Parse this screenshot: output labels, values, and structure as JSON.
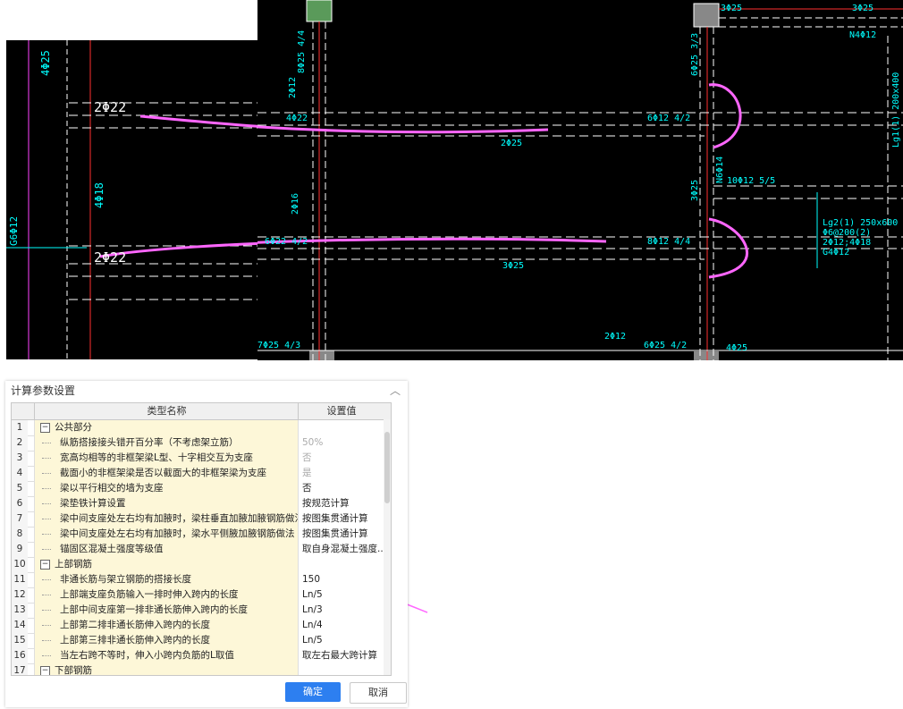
{
  "cad_left": {
    "labels": [
      "4Φ25",
      "2Φ22",
      "4Φ18",
      "G6Φ12",
      "2Φ22"
    ]
  },
  "cad_right": {
    "labels": [
      "8Φ25 4/4",
      "2Φ12",
      "4Φ22",
      "2Φ25",
      "6Φ12 4/2",
      "6Φ25 3/3",
      "3Φ25",
      "3Φ25",
      "N4Φ12",
      "Lg1(1) 200x400",
      "N6Φ14",
      "10Φ12 5/5",
      "3Φ25",
      "2Φ16",
      "6Φ22 4/2",
      "8Φ12 4/4",
      "3Φ25",
      "Lg2(1) 250x600",
      "Φ6@200(2)",
      "2Φ12;4Φ18",
      "G4Φ12",
      "7Φ25 4/3",
      "2Φ12",
      "6Φ25 4/2",
      "4Φ25"
    ]
  },
  "dialog": {
    "title": "计算参数设置",
    "col_name": "类型名称",
    "col_value": "设置值",
    "ok_label": "确定",
    "cancel_label": "取消",
    "rows": [
      {
        "num": "1",
        "name": "公共部分",
        "value": "",
        "group": true
      },
      {
        "num": "2",
        "name": "纵筋搭接接头错开百分率（不考虑架立筋）",
        "value": "50%",
        "disabled": true
      },
      {
        "num": "3",
        "name": "宽高均相等的非框架梁L型、十字相交互为支座",
        "value": "否",
        "disabled": true
      },
      {
        "num": "4",
        "name": "截面小的非框架梁是否以截面大的非框架梁为支座",
        "value": "是",
        "disabled": true
      },
      {
        "num": "5",
        "name": "梁以平行相交的墙为支座",
        "value": "否"
      },
      {
        "num": "6",
        "name": "梁垫铁计算设置",
        "value": "按规范计算"
      },
      {
        "num": "7",
        "name": "梁中间支座处左右均有加腋时，梁柱垂直加腋加腋钢筋做法",
        "value": "按图集贯通计算"
      },
      {
        "num": "8",
        "name": "梁中间支座处左右均有加腋时，梁水平侧腋加腋钢筋做法",
        "value": "按图集贯通计算"
      },
      {
        "num": "9",
        "name": "锚固区混凝土强度等级值",
        "value": "取自身混凝土强度..."
      },
      {
        "num": "10",
        "name": "上部钢筋",
        "value": "",
        "group": true
      },
      {
        "num": "11",
        "name": "非通长筋与架立钢筋的搭接长度",
        "value": "150"
      },
      {
        "num": "12",
        "name": "上部端支座负筋输入一排时伸入跨内的长度",
        "value": "Ln/5"
      },
      {
        "num": "13",
        "name": "上部中间支座第一排非通长筋伸入跨内的长度",
        "value": "Ln/3"
      },
      {
        "num": "14",
        "name": "上部第二排非通长筋伸入跨内的长度",
        "value": "Ln/4"
      },
      {
        "num": "15",
        "name": "上部第三排非通长筋伸入跨内的长度",
        "value": "Ln/5"
      },
      {
        "num": "16",
        "name": "当左右跨不等时，伸入小跨内负筋的L取值",
        "value": "取左右最大跨计算"
      },
      {
        "num": "17",
        "name": "下部钢筋",
        "value": "",
        "group": true
      }
    ]
  },
  "colors": {
    "cad_line": "#ffffff",
    "cad_text": "#00ffff",
    "cad_red": "#ff3030",
    "highlight": "#ff66ff",
    "ok_button": "#2d7ff0"
  },
  "icons": {
    "collapse": "minus-box-icon",
    "close": "close-icon"
  }
}
